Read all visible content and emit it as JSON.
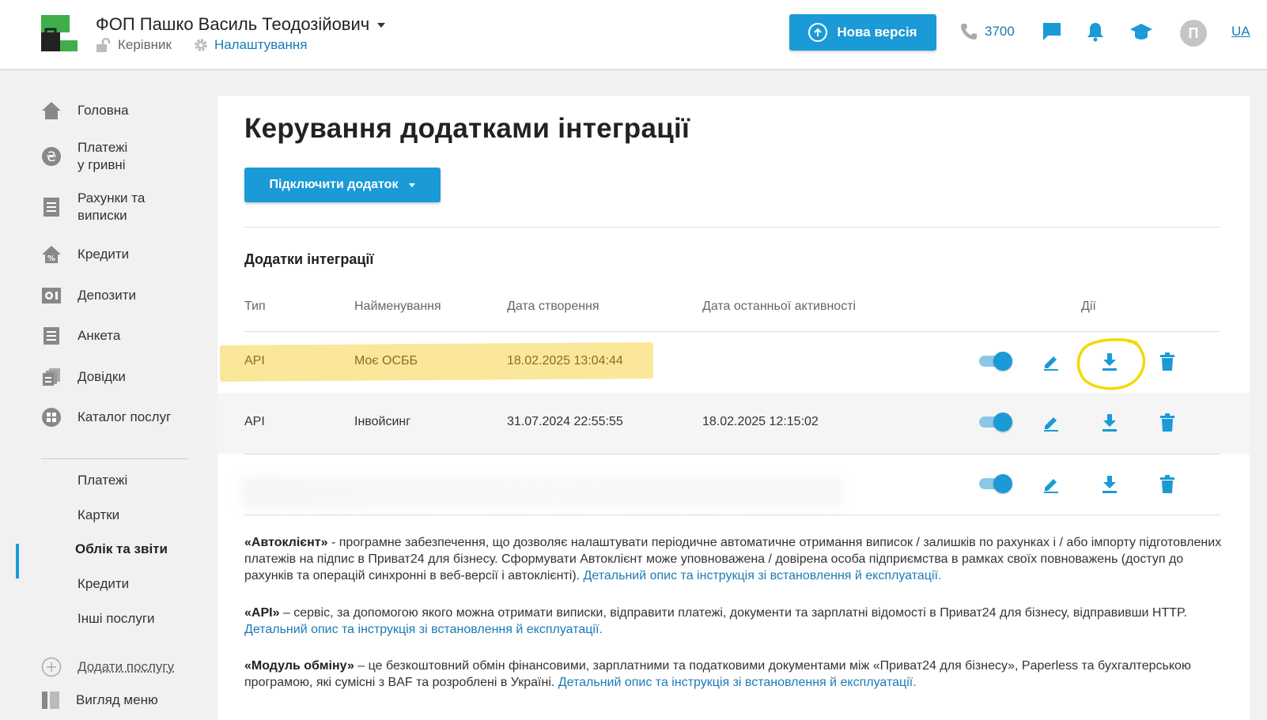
{
  "header": {
    "company": "ФОП Пашко Василь Теодозійович",
    "role": "Керівник",
    "settings": "Налаштування",
    "new_version": "Нова версія",
    "phone": "3700",
    "avatar_letter": "П",
    "lang": "UA"
  },
  "sidebar": {
    "items": [
      {
        "label": "Головна",
        "icon": "home-icon"
      },
      {
        "label": "Платежі\nу гривні",
        "icon": "hryvnia-icon"
      },
      {
        "label": "Рахунки та\nвиписки",
        "icon": "document-icon"
      },
      {
        "label": "Кредити",
        "icon": "house-percent-icon"
      },
      {
        "label": "Депозити",
        "icon": "deposit-icon"
      },
      {
        "label": "Анкета",
        "icon": "form-icon"
      },
      {
        "label": "Довідки",
        "icon": "certificates-icon"
      },
      {
        "label": "Каталог послуг",
        "icon": "catalog-icon"
      }
    ],
    "sub_items": [
      "Платежі",
      "Картки",
      "Облік та звіти",
      "Кредити",
      "Інші послуги"
    ],
    "active_sub": "Облік та звіти",
    "add_service": "Додати послугу",
    "menu_view": "Вигляд меню"
  },
  "main": {
    "title": "Керування додатками інтеграції",
    "connect_button": "Підключити додаток",
    "section_title": "Додатки інтеграції",
    "columns": [
      "Тип",
      "Найменування",
      "Дата створення",
      "Дата останньої активності",
      "Дії"
    ],
    "rows": [
      {
        "type": "API",
        "name": "Моє ОСББ",
        "created": "18.02.2025 13:04:44",
        "last_active": ""
      },
      {
        "type": "API",
        "name": "Інвойсинг",
        "created": "31.07.2024 22:55:55",
        "last_active": "18.02.2025 12:15:02"
      },
      {
        "type": "",
        "name": "",
        "created": "",
        "last_active": ""
      }
    ],
    "desc": {
      "auto_title": "«Автоклієнт»",
      "auto_text": " - програмне забезпечення, що дозволяє налаштувати періодичне автоматичне отримання виписок / залишків по рахунках і / або імпорту підготовлених платежів на підпис в Приват24 для бізнесу. Сформувати Автоклієнт може уповноважена / довірена особа підприємства в рамках своїх повноважень (доступ до рахунків та операцій синхронні в веб-версії і автоклієнті). ",
      "auto_link": "Детальний опис та інструкція зі встановлення й експлуатації.",
      "api_title": "«API»",
      "api_text": " – сервіс, за допомогою якого можна отримати виписки, відправити платежі, документи та зарплатні відомості в Приват24 для бізнесу, відправивши HTTP. ",
      "api_link": "Детальний опис та інструкція зі встановлення й експлуатації.",
      "mod_title": "«Модуль обміну»",
      "mod_text": " – це безкоштовний обмін фінансовими, зарплатними та податковими документами між «Приват24 для бізнесу», Paperless та бухгалтерською програмою, які сумісні з BAF та розроблені в Україні. ",
      "mod_link": "Детальний опис та інструкція зі встановлення й експлуатації."
    }
  },
  "colors": {
    "accent": "#1a9ad6",
    "link": "#1a7bb8",
    "highlight": "#fbe79a",
    "annotation": "#f5d800",
    "logo_green": "#3fae4a"
  }
}
